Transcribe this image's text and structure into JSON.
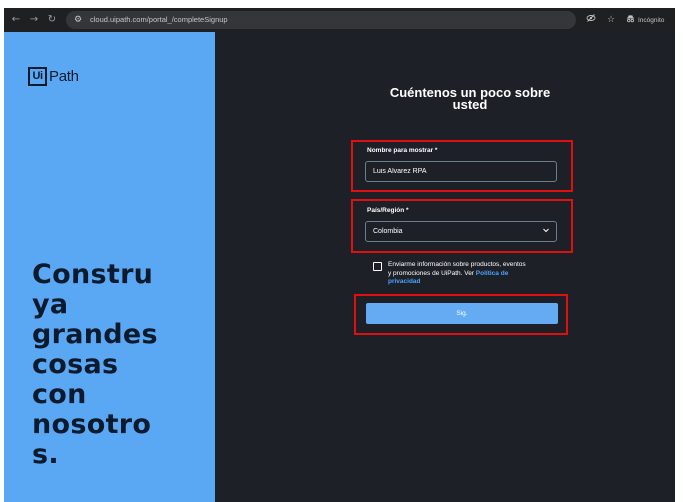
{
  "browser": {
    "url": "cloud.uipath.com/portal_/completeSignup",
    "incognito_label": "Incógnito",
    "icons": [
      "back-icon",
      "forward-icon",
      "reload-icon",
      "site-info-icon",
      "eye-off-icon",
      "star-icon",
      "incognito-icon"
    ]
  },
  "left": {
    "logo_box": "Ui",
    "logo_text": "Path",
    "headline_lines": [
      "Constru",
      "ya",
      "grandes",
      "cosas",
      "con",
      "nosotro",
      "s."
    ]
  },
  "form": {
    "title_line1": "Cuéntenos un poco sobre",
    "title_line2": "usted",
    "display_name_label": "Nombre para mostrar *",
    "display_name_value": "Luis Alvarez RPA",
    "country_label": "País/Región *",
    "country_value": "Colombia",
    "consent_line1": "Enviarme información sobre productos, eventos",
    "consent_line2_prefix": "y promociones de UiPath. Ver ",
    "consent_link_part1": "Política de",
    "consent_link_part2": "privacidad",
    "submit_label": "Sig."
  },
  "colors": {
    "left_panel": "#5aa8f4",
    "right_panel": "#1d2127",
    "highlight": "#e01010",
    "button": "#64abf4",
    "link": "#4aa3ff"
  }
}
